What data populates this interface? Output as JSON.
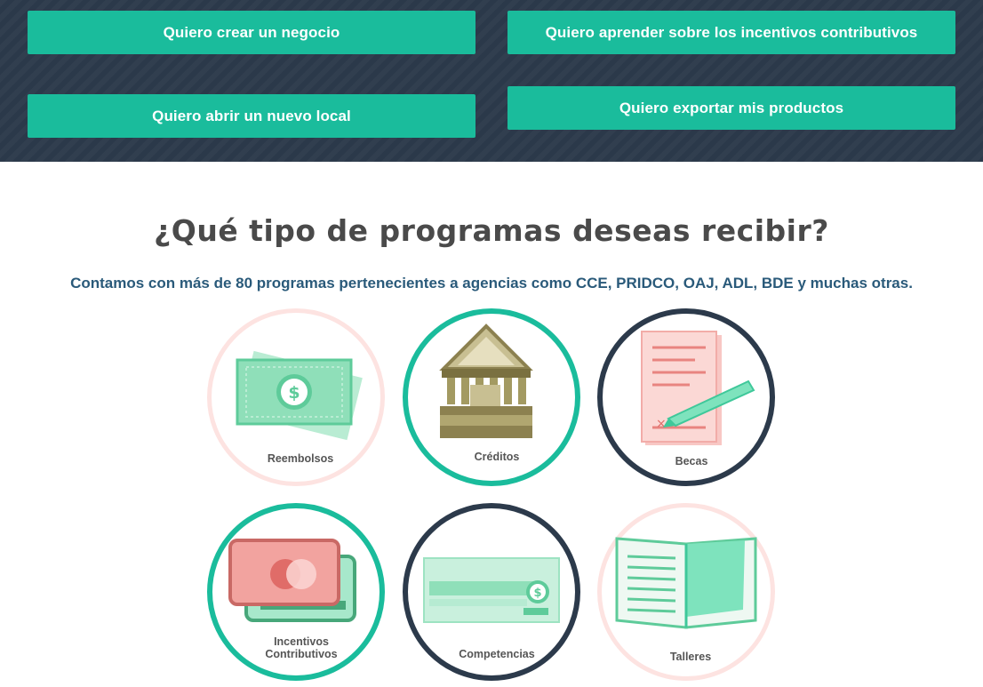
{
  "actions": {
    "create_business": "Quiero crear un negocio",
    "learn_incentives": "Quiero aprender sobre los incentivos contributivos",
    "open_location": "Quiero abrir un nuevo local",
    "export_products": "Quiero exportar mis productos"
  },
  "section": {
    "title": "¿Qué tipo de programas deseas recibir?",
    "subtitle": "Contamos con más de 80 programas pertenecientes a agencias como CCE, PRIDCO, OAJ, ADL, BDE y muchas otras."
  },
  "programs": [
    {
      "label": "Reembolsos",
      "icon": "money-bills-icon"
    },
    {
      "label": "Créditos",
      "icon": "bank-icon"
    },
    {
      "label": "Becas",
      "icon": "certificate-pen-icon"
    },
    {
      "label_line1": "Incentivos",
      "label_line2": "Contributivos",
      "icon": "credit-cards-icon"
    },
    {
      "label": "Competencias",
      "icon": "check-icon"
    },
    {
      "label": "Talleres",
      "icon": "open-book-icon"
    }
  ],
  "colors": {
    "band": "#2c3a4b",
    "accent": "#1abc9c",
    "navy": "#2c3a4b",
    "pink": "#fde3e1"
  }
}
